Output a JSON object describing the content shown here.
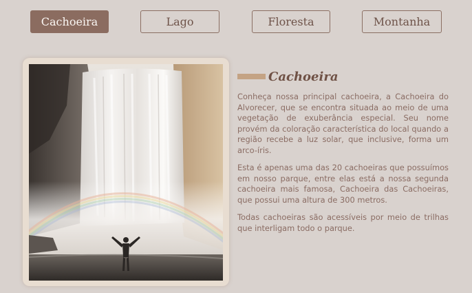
{
  "nav": {
    "tabs": [
      {
        "label": "Cachoeira",
        "active": true
      },
      {
        "label": "Lago",
        "active": false
      },
      {
        "label": "Floresta",
        "active": false
      },
      {
        "label": "Montanha",
        "active": false
      }
    ]
  },
  "photo": {
    "subject": "waterfall-with-rainbow-and-person"
  },
  "article": {
    "title": "Cachoeira",
    "paragraphs": [
      "Conheça nossa principal cachoeira, a Cachoeira do Alvorecer, que se encontra situada ao meio de uma vegetação de exuberância especial. Seu nome provém da coloração característica do local quando a região recebe a luz solar, que inclusive, forma um arco-íris.",
      "Esta é apenas uma das 20 cachoeiras que possuímos em nosso parque, entre elas está a nossa segunda cachoeira mais famosa, Cachoeira das Cachoeiras, que possui uma altura de 300 metros.",
      "Todas cachoeiras são acessíveis por meio de trilhas que interligam todo o parque."
    ]
  },
  "colors": {
    "background": "#d9d2ce",
    "accent": "#8b6c60",
    "accent_bar": "#c4a384",
    "text": "#8a6c63"
  }
}
